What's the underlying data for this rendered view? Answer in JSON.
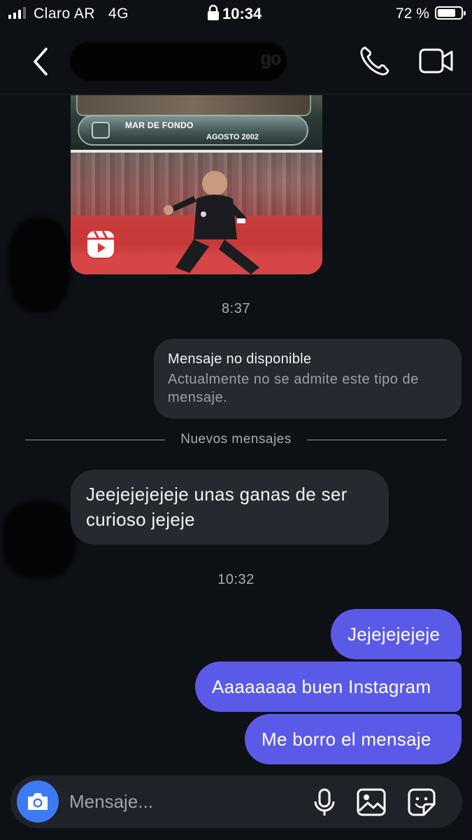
{
  "status_bar": {
    "carrier": "Claro AR",
    "network": "4G",
    "time": "10:34",
    "battery": "72 %",
    "battery_level": 0.72
  },
  "header": {
    "contact_name_visible": "go",
    "back_icon": "chevron-left-icon",
    "call_icon": "phone-icon",
    "video_icon": "video-camera-icon"
  },
  "reel": {
    "caption_title": "MAR DE FONDO",
    "caption_date": "AGOSTO 2002",
    "badge_icon": "reels-icon"
  },
  "messages": [
    {
      "type": "timestamp",
      "text": "8:37"
    },
    {
      "type": "unsupported",
      "title": "Mensaje no disponible",
      "body": "Actualmente no se admite este tipo de mensaje."
    },
    {
      "type": "divider",
      "text": "Nuevos mensajes"
    },
    {
      "type": "incoming",
      "text": "Jeejejejejeje unas ganas de ser curioso jejeje"
    },
    {
      "type": "timestamp",
      "text": "10:32"
    },
    {
      "type": "outgoing",
      "text": "Jejejejejeje"
    },
    {
      "type": "outgoing",
      "text": "Aaaaaaaa buen Instagram"
    },
    {
      "type": "outgoing",
      "text": "Me borro el mensaje"
    }
  ],
  "composer": {
    "placeholder": "Mensaje...",
    "camera_icon": "camera-icon",
    "mic_icon": "microphone-icon",
    "gallery_icon": "image-icon",
    "sticker_icon": "sticker-icon"
  },
  "colors": {
    "background": "#0d1015",
    "incoming_bubble": "#262a30",
    "outgoing_bubble": "#5b5ae8",
    "camera_button": "#3d7bf5"
  }
}
